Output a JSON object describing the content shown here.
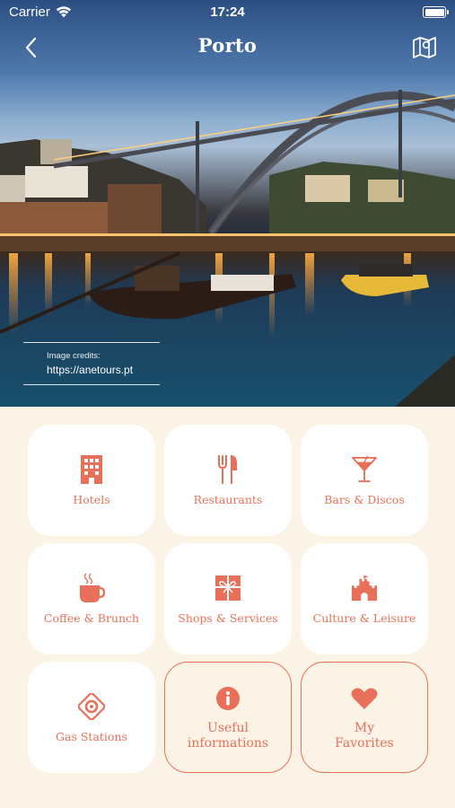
{
  "status_bar": {
    "carrier": "Carrier",
    "time": "17:24"
  },
  "header": {
    "title": "Porto"
  },
  "hero": {
    "credits_label": "Image credits:",
    "credits_url": "https://anetours.pt"
  },
  "categories": [
    {
      "label": "Hotels",
      "icon": "hotel-building-icon"
    },
    {
      "label": "Restaurants",
      "icon": "fork-knife-icon"
    },
    {
      "label": "Bars & Discos",
      "icon": "cocktail-glass-icon"
    },
    {
      "label": "Coffee & Brunch",
      "icon": "coffee-cup-icon"
    },
    {
      "label": "Shops & Services",
      "icon": "gift-box-icon"
    },
    {
      "label": "Culture & Leisure",
      "icon": "castle-icon"
    },
    {
      "label": "Gas Stations",
      "icon": "gas-station-icon"
    },
    {
      "label": "Useful\ninformations",
      "icon": "info-icon"
    },
    {
      "label": "My\nFavorites",
      "icon": "heart-icon"
    }
  ],
  "colors": {
    "accent": "#e8705a",
    "background": "#fbf3e6",
    "tile": "#ffffff"
  }
}
